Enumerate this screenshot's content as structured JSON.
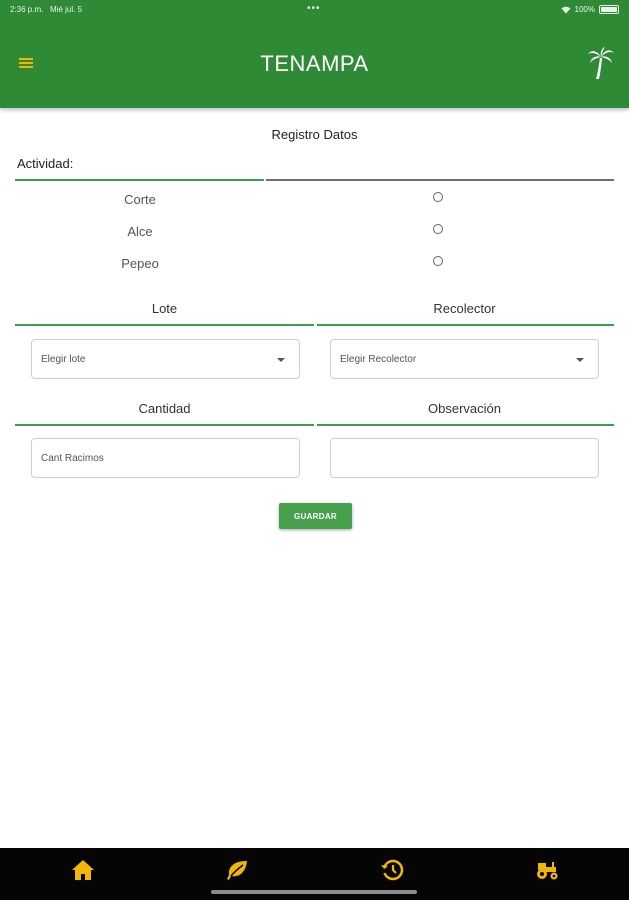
{
  "status_bar": {
    "time": "2:36 p.m.",
    "date": "Mié jul. 5",
    "center": "•••",
    "battery_text": "100%"
  },
  "app_bar": {
    "menu_icon": "hamburger-menu-icon",
    "title": "TENAMPA",
    "right_icon": "palm-tree-icon"
  },
  "form": {
    "title": "Registro Datos",
    "actividad_label": "Actividad:",
    "activities": [
      {
        "label": "Corte",
        "selected": false
      },
      {
        "label": "Alce",
        "selected": false
      },
      {
        "label": "Pepeo",
        "selected": false
      }
    ],
    "lote_header": "Lote",
    "recolector_header": "Recolector",
    "lote_select": {
      "placeholder": "Elegir lote"
    },
    "recolector_select": {
      "placeholder": "Elegir Recolector"
    },
    "cantidad_header": "Cantidad",
    "observacion_header": "Observación",
    "cantidad_input": {
      "placeholder": "Cant Racimos",
      "value": ""
    },
    "observacion_input": {
      "placeholder": "",
      "value": ""
    },
    "save_label": "GUARDAR"
  },
  "bottom_nav": {
    "items": [
      {
        "icon": "home-icon"
      },
      {
        "icon": "leaf-icon"
      },
      {
        "icon": "history-icon"
      },
      {
        "icon": "tractor-icon"
      }
    ]
  },
  "colors": {
    "primary": "#2f8a35",
    "accent": "#f2b705",
    "button": "#46a04e",
    "bottom_bar": "#050505"
  }
}
